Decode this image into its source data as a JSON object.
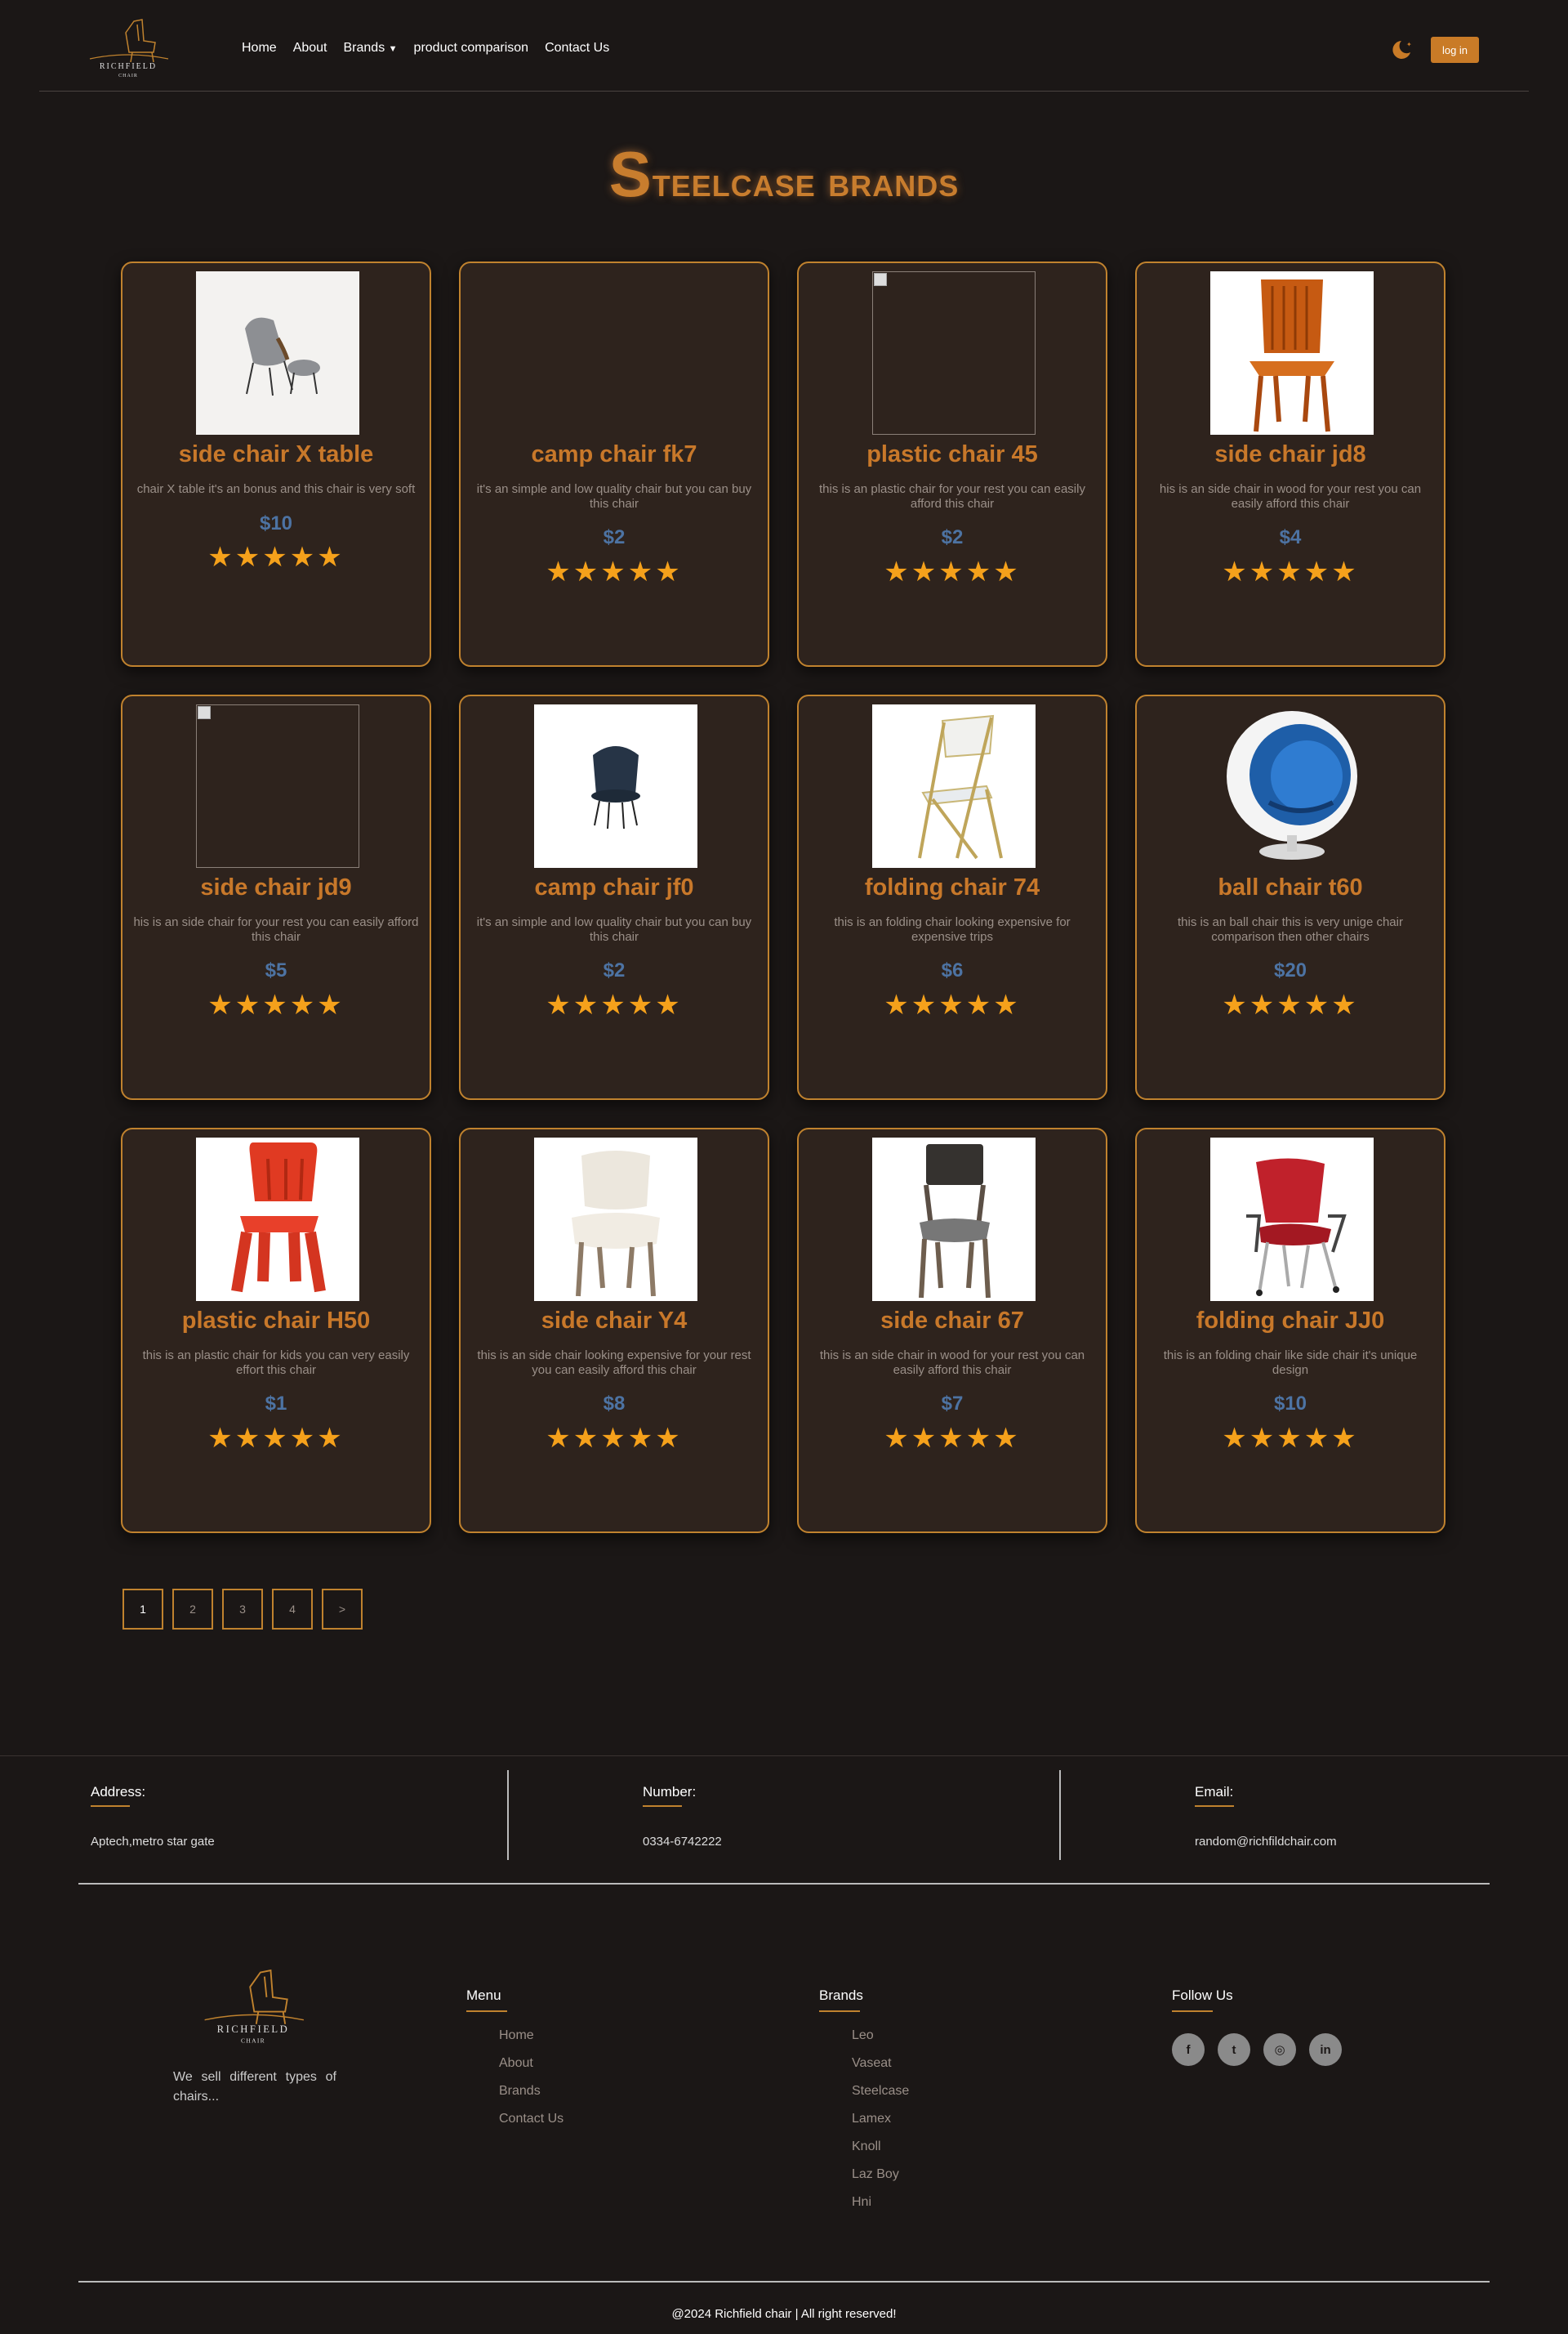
{
  "brand": {
    "name": "RICHFIELD",
    "sub": "CHAIR"
  },
  "nav": {
    "items": [
      "Home",
      "About",
      "Brands",
      "product comparison",
      "Contact Us"
    ],
    "login_label": "log in"
  },
  "title": {
    "first": "S",
    "rest": "teelcase brands"
  },
  "products": [
    {
      "name": "side chair X table",
      "desc": "chair X table it's an bonus and this chair is very soft",
      "price": "$10",
      "stars": "★★★★★",
      "img": "lounge"
    },
    {
      "name": "camp chair fk7",
      "desc": "it's an simple and low quality chair but you can buy this chair",
      "price": "$2",
      "stars": "★★★★★",
      "img": "none"
    },
    {
      "name": "plastic chair 45",
      "desc": "this is an plastic chair for your rest you can easily afford this chair",
      "price": "$2",
      "stars": "★★★★★",
      "img": "broken"
    },
    {
      "name": "side chair jd8",
      "desc": "his is an side chair in wood for your rest you can easily afford this chair",
      "price": "$4",
      "stars": "★★★★★",
      "img": "wood"
    },
    {
      "name": "side chair jd9",
      "desc": "his is an side chair for your rest you can easily afford this chair",
      "price": "$5",
      "stars": "★★★★★",
      "img": "broken"
    },
    {
      "name": "camp chair jf0",
      "desc": "it's an simple and low quality chair but you can buy this chair",
      "price": "$2",
      "stars": "★★★★★",
      "img": "shell"
    },
    {
      "name": "folding chair 74",
      "desc": "this is an folding chair looking expensive for expensive trips",
      "price": "$6",
      "stars": "★★★★★",
      "img": "folding"
    },
    {
      "name": "ball chair t60",
      "desc": "this is an ball chair this is very unige chair comparison then other chairs",
      "price": "$20",
      "stars": "★★★★★",
      "img": "ball"
    },
    {
      "name": "plastic chair H50",
      "desc": "this is an plastic chair for kids you can very easily effort this chair",
      "price": "$1",
      "stars": "★★★★★",
      "img": "kids"
    },
    {
      "name": "side chair Y4",
      "desc": "this is an side chair looking expensive for your rest you can easily afford this chair",
      "price": "$8",
      "stars": "★★★★★",
      "img": "upholstered"
    },
    {
      "name": "side chair 67",
      "desc": "this is an side chair in wood for your rest you can easily afford this chair",
      "price": "$7",
      "stars": "★★★★★",
      "img": "gray"
    },
    {
      "name": "folding chair JJ0",
      "desc": "this is an folding chair like side chair it's unique design",
      "price": "$10",
      "stars": "★★★★★",
      "img": "office"
    }
  ],
  "pagination": [
    "1",
    "2",
    "3",
    "4",
    ">"
  ],
  "contact": [
    {
      "label": "Address:",
      "value": "Aptech,metro star gate"
    },
    {
      "label": "Number:",
      "value": "0334-6742222"
    },
    {
      "label": "Email:",
      "value": "random@richfildchair.com"
    }
  ],
  "footer": {
    "tagline": "We sell different types of chairs...",
    "menu": {
      "title": "Menu",
      "items": [
        "Home",
        "About",
        "Brands",
        "Contact Us"
      ]
    },
    "brands": {
      "title": "Brands",
      "items": [
        "Leo",
        "Vaseat",
        "Steelcase",
        "Lamex",
        "Knoll",
        "Laz Boy",
        "Hni"
      ]
    },
    "follow": {
      "title": "Follow Us",
      "icons": [
        "facebook-icon",
        "twitter-icon",
        "instagram-icon",
        "linkedin-icon"
      ],
      "glyphs": [
        "f",
        "t",
        "◎",
        "in"
      ]
    },
    "copyright": "@2024 Richfield chair | All right reserved!"
  },
  "colors": {
    "accent": "#c0822e",
    "price": "#4d73a3",
    "star": "#f5a11b",
    "bg": "#1b1716",
    "card": "#2e231d"
  }
}
